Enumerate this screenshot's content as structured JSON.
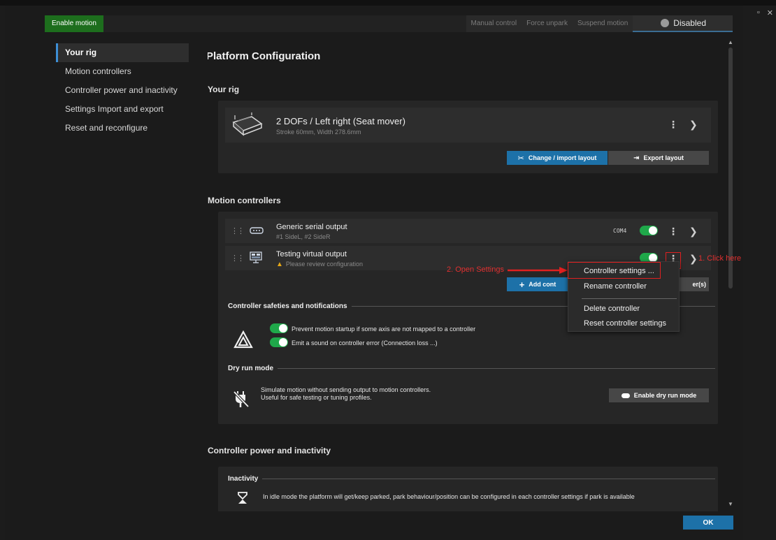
{
  "window": {
    "maximize_glyph": "▫",
    "close_glyph": "✕"
  },
  "topbar": {
    "enable_motion": "Enable motion",
    "manual_control": "Manual control",
    "force_unpark": "Force unpark",
    "suspend_motion": "Suspend motion",
    "motion_state": "Disabled"
  },
  "sidebar": {
    "items": [
      {
        "label": "Your rig"
      },
      {
        "label": "Motion controllers"
      },
      {
        "label": "Controller power and inactivity"
      },
      {
        "label": "Settings Import and export"
      },
      {
        "label": "Reset and reconfigure"
      }
    ]
  },
  "main": {
    "title": "Platform Configuration",
    "your_rig": {
      "heading": "Your rig",
      "name": "2 DOFs / Left right (Seat mover)",
      "details": "Stroke 60mm, Width 278.6mm",
      "change_button": "Change / import layout",
      "export_button": "Export layout"
    },
    "motion_controllers": {
      "heading": "Motion controllers",
      "rows": [
        {
          "name": "Generic serial output",
          "sub": "#1 SideL, #2 SideR",
          "port": "COM4",
          "enabled": true
        },
        {
          "name": "Testing virtual output",
          "sub": "Please review configuration",
          "enabled": true
        }
      ],
      "add_button": "Add cont",
      "other_button_tail": "er(s)"
    },
    "safeties": {
      "heading": "Controller safeties and notifications",
      "options": [
        "Prevent motion startup if some axis are not mapped to a controller",
        "Emit a sound on controller error (Connection loss ...)"
      ]
    },
    "dry_run": {
      "heading": "Dry run mode",
      "line1": "Simulate motion without sending output to motion controllers.",
      "line2": "Useful for safe testing or tuning profiles.",
      "button": "Enable dry run mode"
    },
    "power": {
      "heading": "Controller power and inactivity",
      "inactivity_heading": "Inactivity",
      "inactivity_text": "In idle mode the platform will get/keep parked, park behaviour/position can be configured in each controller settings if park is available"
    }
  },
  "context_menu": {
    "items": [
      "Controller settings ...",
      "Rename controller",
      "Delete controller",
      "Reset controller settings"
    ]
  },
  "annotations": {
    "click_here": "1. Click here",
    "open_settings": "2. Open Settings"
  },
  "footer": {
    "ok": "OK"
  },
  "colors": {
    "accent_blue": "#1d71a8",
    "enable_green": "#1d6e1d",
    "toggle_green": "#1fa84a",
    "annotation_red": "#e02020",
    "warning_yellow": "#e6a817"
  }
}
